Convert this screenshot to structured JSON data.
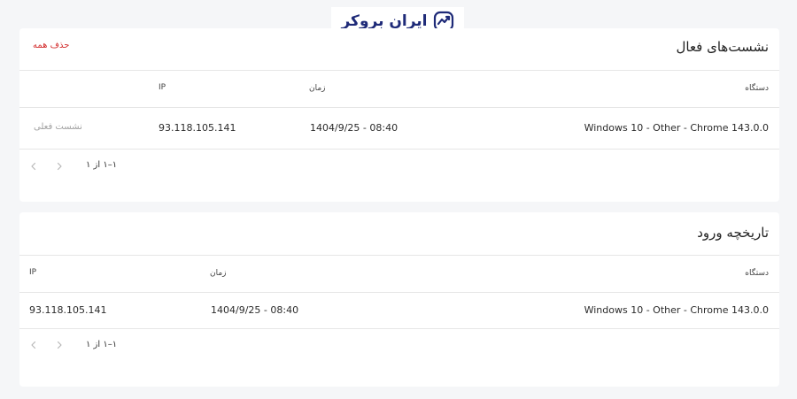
{
  "header": {
    "logo_text": "ایران بروکر",
    "logo_icon": "trend-chart-icon",
    "brand_color": "#1e2a78"
  },
  "sessions": {
    "title": "نشست‌های فعال",
    "delete_all_label": "حذف همه",
    "columns": {
      "device": "دستگاه",
      "time": "زمان",
      "ip": "IP"
    },
    "rows": [
      {
        "device": "Windows 10 - Other - Chrome 143.0.0",
        "time": "1404/9/25 - 08:40",
        "ip": "93.118.105.141",
        "status": "نشست فعلی"
      }
    ],
    "pagination": {
      "range": "۱–۱ از ۱",
      "prev_icon": "chevron-right-icon",
      "next_icon": "chevron-left-icon"
    }
  },
  "history": {
    "title": "تاریخچه ورود",
    "columns": {
      "device": "دستگاه",
      "time": "زمان",
      "ip": "IP"
    },
    "rows": [
      {
        "device": "Windows 10 - Other - Chrome 143.0.0",
        "time": "1404/9/25 - 08:40",
        "ip": "93.118.105.141"
      }
    ],
    "pagination": {
      "range": "۱–۱ از ۱",
      "prev_icon": "chevron-right-icon",
      "next_icon": "chevron-left-icon"
    }
  },
  "colors": {
    "danger": "#d32f2f",
    "muted_text": "#a0a0a0",
    "page_bg": "#f5f6f8"
  }
}
